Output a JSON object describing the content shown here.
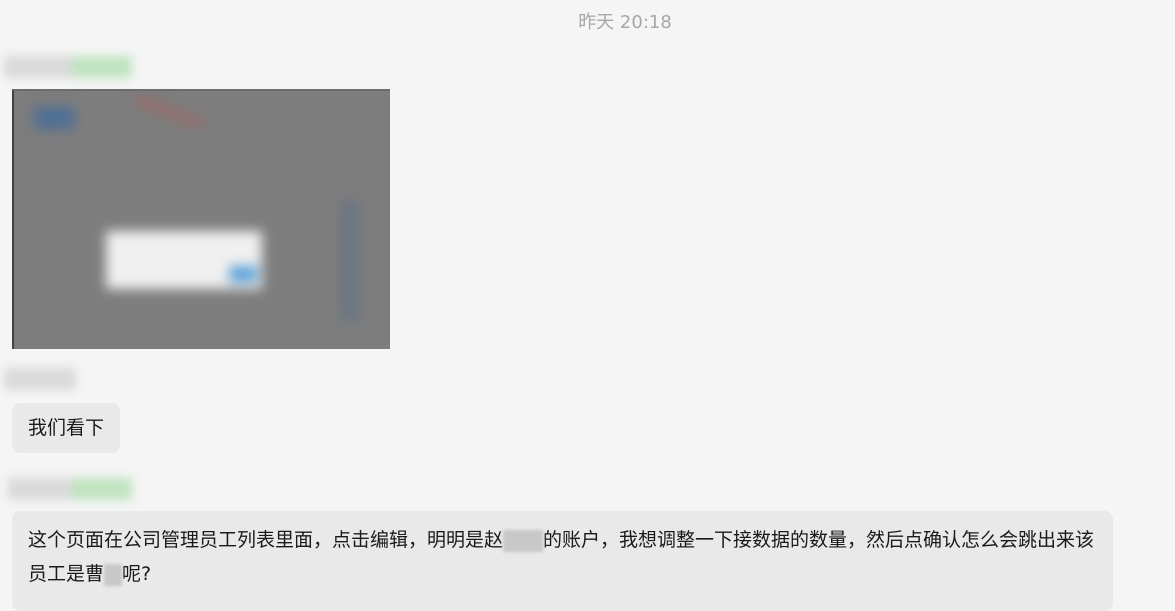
{
  "timestamp": "昨天 20:18",
  "messages": [
    {
      "type": "image",
      "sender_name": "",
      "content": ""
    },
    {
      "type": "text",
      "sender_name": "",
      "text": "我们看下"
    },
    {
      "type": "text",
      "sender_name": "",
      "text_part1": "这个页面在公司管理员工列表里面，点击编辑，明明是赵",
      "text_part2": "的账户，我想调整一下接数据的数量，然后点确认怎么会跳出来该员工是曹",
      "text_part3": "呢?"
    }
  ],
  "colors": {
    "background": "#f5f5f5",
    "bubble": "#e9e9e9",
    "timestamp": "#a7a7a7"
  }
}
